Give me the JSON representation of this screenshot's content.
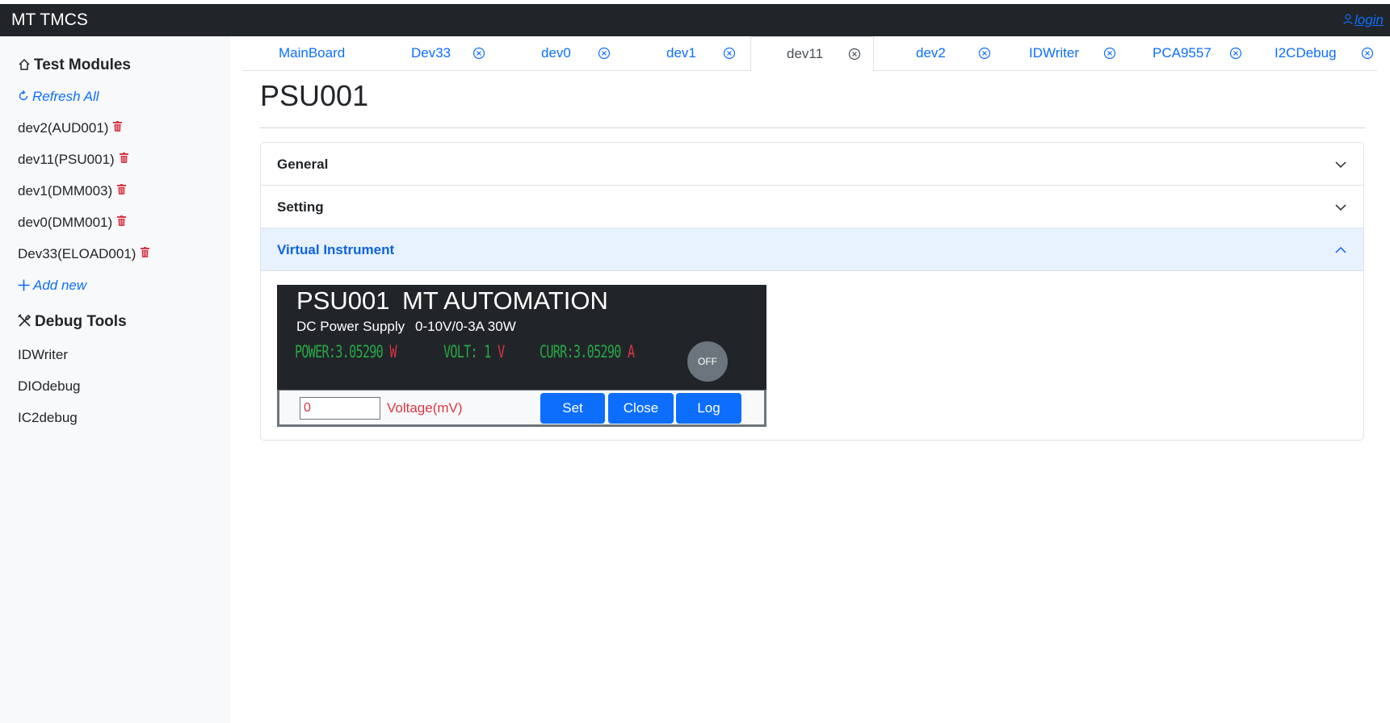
{
  "app": {
    "title": "MT TMCS",
    "login_label": "login"
  },
  "sidebar": {
    "test_modules_heading": "Test Modules",
    "refresh_all": "Refresh All",
    "modules": [
      {
        "label": "dev2(AUD001)"
      },
      {
        "label": "dev11(PSU001)"
      },
      {
        "label": "dev1(DMM003)"
      },
      {
        "label": "dev0(DMM001)"
      },
      {
        "label": "Dev33(ELOAD001)"
      }
    ],
    "add_new": "Add new",
    "debug_tools_heading": "Debug Tools",
    "debug_tools": [
      {
        "label": "IDWriter"
      },
      {
        "label": "DIOdebug"
      },
      {
        "label": "IC2debug"
      }
    ]
  },
  "tabs": [
    {
      "label": "MainBoard",
      "closable": false
    },
    {
      "label": "Dev33",
      "closable": true
    },
    {
      "label": "dev0",
      "closable": true
    },
    {
      "label": "dev1",
      "closable": true
    },
    {
      "label": "dev11",
      "closable": true,
      "active": true
    },
    {
      "label": "dev2",
      "closable": true
    },
    {
      "label": "IDWriter",
      "closable": true
    },
    {
      "label": "PCA9557",
      "closable": true
    },
    {
      "label": "I2CDebug",
      "closable": true
    }
  ],
  "page": {
    "title": "PSU001"
  },
  "accordion": [
    {
      "label": "General",
      "open": false
    },
    {
      "label": "Setting",
      "open": false
    },
    {
      "label": "Virtual Instrument",
      "open": true
    }
  ],
  "instrument": {
    "name": "PSU001",
    "brand": "MT AUTOMATION",
    "type": "DC Power Supply",
    "spec": "0-10V/0-3A 30W",
    "power_label": "POWER:",
    "power_value": "3.05290",
    "power_unit": "W",
    "volt_label": "VOLT:",
    "volt_value": "1",
    "volt_unit": "V",
    "curr_label": "CURR:",
    "curr_value": "3.05290",
    "curr_unit": "A",
    "power_state": "OFF",
    "input_value": "0",
    "input_unit_label": "Voltage(mV)",
    "set_label": "Set",
    "close_label": "Close",
    "log_label": "Log"
  },
  "colors": {
    "topbar": "#212529",
    "accent": "#0d6efd",
    "display_green": "#28a745",
    "unit_red": "#dc3545",
    "sidebar_bg": "#f8f9fa"
  }
}
